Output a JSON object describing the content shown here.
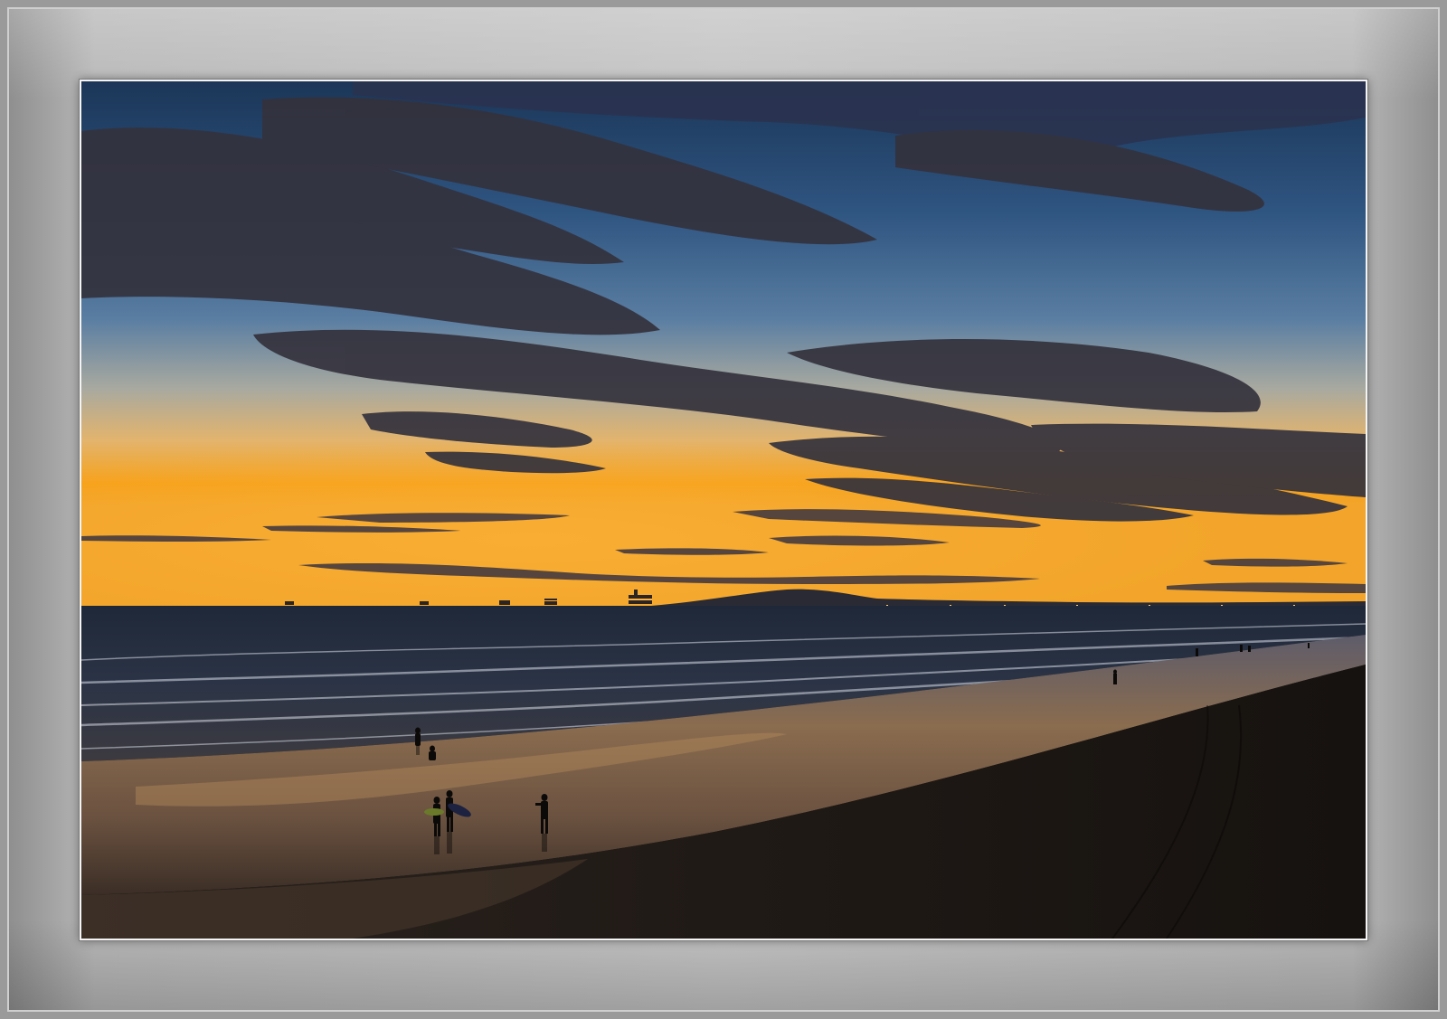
{
  "image": {
    "kind": "framed photograph",
    "subject": "sunset-beach",
    "colors": {
      "mat": "#c0c0c0",
      "sky_top": "#1f3d63",
      "sky_mid": "#5d82a6",
      "horizon_glow": "#f6a11a",
      "clouds": "#3c3b45",
      "sea": "#243040",
      "wet_sand": "#6d5844",
      "dry_sand": "#1c1816"
    }
  }
}
